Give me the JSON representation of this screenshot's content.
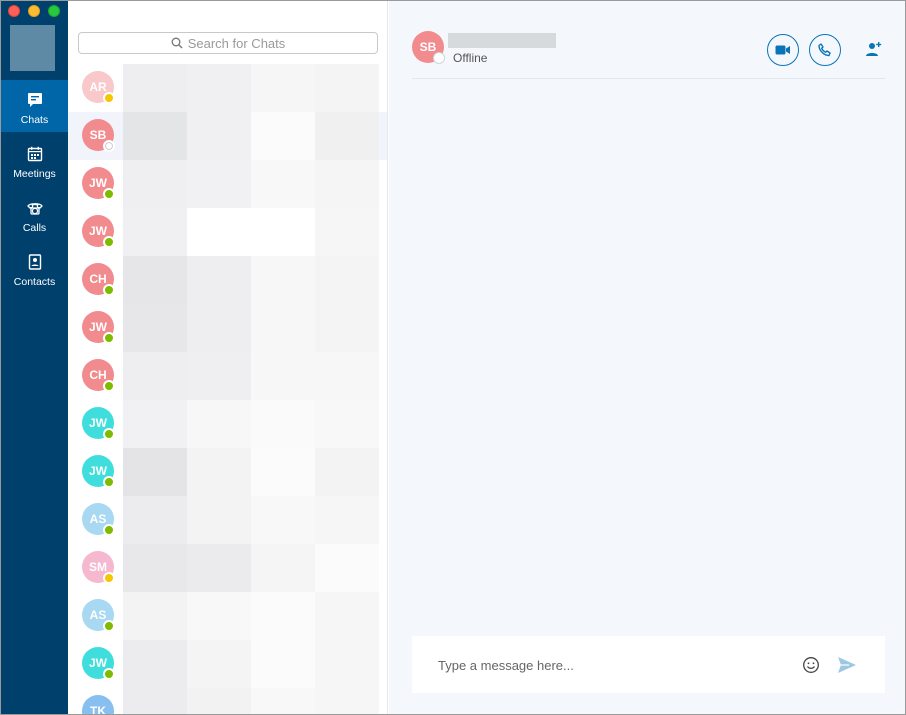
{
  "sidebar": {
    "items": [
      {
        "label": "Chats",
        "icon": "chat-icon"
      },
      {
        "label": "Meetings",
        "icon": "calendar-icon"
      },
      {
        "label": "Calls",
        "icon": "phone-icon"
      },
      {
        "label": "Contacts",
        "icon": "contacts-icon"
      }
    ]
  },
  "search": {
    "placeholder": "Search for Chats"
  },
  "chats": [
    {
      "initials": "AR",
      "color": "#f8c8cb",
      "presence": "away"
    },
    {
      "initials": "SB",
      "color": "#f28b8e",
      "presence": "offline",
      "selected": true
    },
    {
      "initials": "JW",
      "color": "#f28b8e",
      "presence": "online"
    },
    {
      "initials": "JW",
      "color": "#f28b8e",
      "presence": "online"
    },
    {
      "initials": "CH",
      "color": "#f28b8e",
      "presence": "online"
    },
    {
      "initials": "JW",
      "color": "#f28b8e",
      "presence": "online"
    },
    {
      "initials": "CH",
      "color": "#f28b8e",
      "presence": "online"
    },
    {
      "initials": "JW",
      "color": "#3fdedd",
      "presence": "online"
    },
    {
      "initials": "JW",
      "color": "#3fdedd",
      "presence": "online"
    },
    {
      "initials": "AS",
      "color": "#a9d8f2",
      "presence": "online"
    },
    {
      "initials": "SM",
      "color": "#f5b8cf",
      "presence": "away"
    },
    {
      "initials": "AS",
      "color": "#a9d8f2",
      "presence": "online"
    },
    {
      "initials": "JW",
      "color": "#3fdedd",
      "presence": "online"
    },
    {
      "initials": "TK",
      "color": "#86bff0",
      "presence": "online"
    }
  ],
  "conversation": {
    "avatar_initials": "SB",
    "status": "Offline",
    "message_placeholder": "Type a message here..."
  },
  "colors": {
    "sidebar_bg": "#00406d",
    "sidebar_active": "#0066a8",
    "accent": "#0b74b8"
  }
}
